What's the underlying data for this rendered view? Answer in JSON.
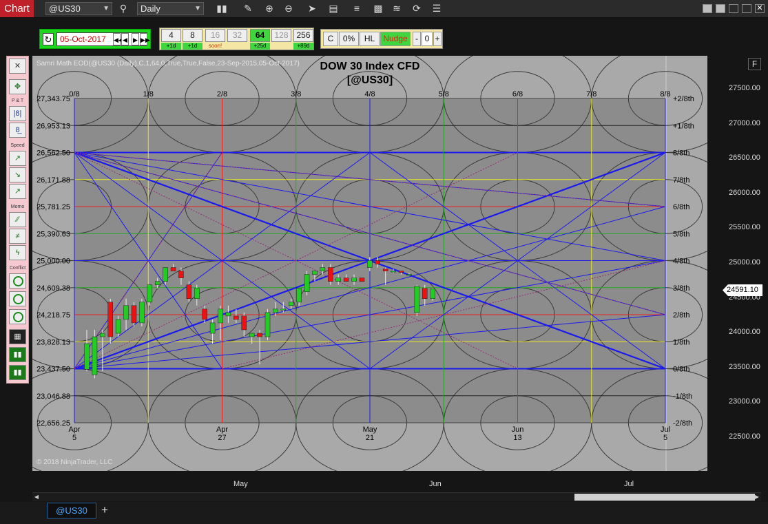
{
  "titlebar": {
    "app_tab": "Chart",
    "instrument": "@US30",
    "period": "Daily"
  },
  "toolbar2": {
    "date": "05-Oct-2017",
    "zoom_levels": [
      {
        "value": "4",
        "label": "+1d"
      },
      {
        "value": "8",
        "label": "+1d"
      },
      {
        "value": "16",
        "label": "soon!"
      },
      {
        "value": "32",
        "label": ""
      },
      {
        "value": "64",
        "label": "+25d"
      },
      {
        "value": "128",
        "label": ""
      },
      {
        "value": "256",
        "label": "+89d"
      }
    ],
    "mode_buttons": [
      "C",
      "0%",
      "HL",
      "Nudge"
    ],
    "nudge_minus": "-",
    "nudge_value": "0",
    "nudge_plus": "+"
  },
  "left_panel": {
    "labels": [
      "P & T",
      "Speed",
      "Momo",
      "Conflict"
    ]
  },
  "chart": {
    "header_text": "Samri Math EOD(@US30 (Daily),C,1,64,0,True,True,False,23-Sep-2015,05-Oct-2017)",
    "title_line1": "DOW 30 Index CFD",
    "title_line2": "[@US30]",
    "copyright": "© 2018 NinjaTrader, LLC",
    "f_button": "F",
    "last_price": "24591.10"
  },
  "chart_data": {
    "type": "candlestick",
    "grid_price_labels": [
      "27,343.75",
      "26,953.13",
      "26,562.50",
      "26,171.88",
      "25,781.25",
      "25,390.63",
      "25,000.00",
      "24,609.38",
      "24,218.75",
      "23,828.13",
      "23,437.50",
      "23,046.88",
      "22,656.25"
    ],
    "grid_octave_labels": [
      "+2/8th",
      "+1/8th",
      "8/8th",
      "7/8th",
      "6/8th",
      "5/8th",
      "4/8th",
      "3/8th",
      "2/8th",
      "1/8th",
      "0/8th",
      "-1/8th",
      "-2/8th"
    ],
    "time_fraction_labels": [
      "0/8",
      "1/8",
      "2/8",
      "3/8",
      "4/8",
      "5/8",
      "6/8",
      "7/8",
      "8/8"
    ],
    "inner_x_labels": [
      {
        "month": "Apr",
        "day": "5"
      },
      {
        "month": "Apr",
        "day": "27"
      },
      {
        "month": "May",
        "day": "21"
      },
      {
        "month": "Jun",
        "day": "13"
      },
      {
        "month": "Jul",
        "day": "5"
      }
    ],
    "right_axis_labels": [
      "27500.00",
      "27000.00",
      "26500.00",
      "26000.00",
      "25500.00",
      "25000.00",
      "24500.00",
      "24000.00",
      "23500.00",
      "23000.00",
      "22500.00"
    ],
    "bottom_axis_labels": [
      "May",
      "Jun",
      "Jul"
    ],
    "candles": [
      {
        "o": 23430,
        "h": 24000,
        "l": 23400,
        "c": 23800
      },
      {
        "o": 23350,
        "h": 24000,
        "l": 23300,
        "c": 23900
      },
      {
        "o": 23900,
        "h": 24000,
        "l": 23400,
        "c": 23950
      },
      {
        "o": 24400,
        "h": 24450,
        "l": 23800,
        "c": 23900
      },
      {
        "o": 23950,
        "h": 24200,
        "l": 23900,
        "c": 24150
      },
      {
        "o": 24150,
        "h": 24450,
        "l": 24000,
        "c": 24350
      },
      {
        "o": 24350,
        "h": 24400,
        "l": 24050,
        "c": 24100
      },
      {
        "o": 24100,
        "h": 24450,
        "l": 24050,
        "c": 24400
      },
      {
        "o": 24400,
        "h": 24650,
        "l": 24350,
        "c": 24650
      },
      {
        "o": 24650,
        "h": 24750,
        "l": 24600,
        "c": 24700
      },
      {
        "o": 24700,
        "h": 24900,
        "l": 24650,
        "c": 24900
      },
      {
        "o": 24900,
        "h": 24950,
        "l": 24850,
        "c": 24850
      },
      {
        "o": 24850,
        "h": 24900,
        "l": 24650,
        "c": 24750
      },
      {
        "o": 24650,
        "h": 24700,
        "l": 24400,
        "c": 24450
      },
      {
        "o": 24450,
        "h": 24650,
        "l": 24350,
        "c": 24600
      },
      {
        "o": 24300,
        "h": 24350,
        "l": 24100,
        "c": 24150
      },
      {
        "o": 23950,
        "h": 24150,
        "l": 23800,
        "c": 24100
      },
      {
        "o": 24100,
        "h": 24350,
        "l": 23850,
        "c": 24300
      },
      {
        "o": 24200,
        "h": 24350,
        "l": 24100,
        "c": 24250
      },
      {
        "o": 24200,
        "h": 24300,
        "l": 24100,
        "c": 24150
      },
      {
        "o": 24200,
        "h": 24250,
        "l": 23900,
        "c": 24000
      },
      {
        "o": 23900,
        "h": 23950,
        "l": 23800,
        "c": 23950
      },
      {
        "o": 23950,
        "h": 24000,
        "l": 23500,
        "c": 23900
      },
      {
        "o": 23900,
        "h": 24300,
        "l": 23850,
        "c": 24250
      },
      {
        "o": 24250,
        "h": 24400,
        "l": 24200,
        "c": 24300
      },
      {
        "o": 24300,
        "h": 24400,
        "l": 24250,
        "c": 24300
      },
      {
        "o": 24350,
        "h": 24450,
        "l": 24300,
        "c": 24400
      },
      {
        "o": 24400,
        "h": 24600,
        "l": 24350,
        "c": 24600
      },
      {
        "o": 24550,
        "h": 24850,
        "l": 24500,
        "c": 24800
      },
      {
        "o": 24800,
        "h": 24850,
        "l": 24700,
        "c": 24850
      },
      {
        "o": 24850,
        "h": 24950,
        "l": 24800,
        "c": 24900
      },
      {
        "o": 24900,
        "h": 24950,
        "l": 24650,
        "c": 24700
      },
      {
        "o": 24700,
        "h": 24800,
        "l": 24650,
        "c": 24750
      },
      {
        "o": 24750,
        "h": 24800,
        "l": 24700,
        "c": 24700
      },
      {
        "o": 24700,
        "h": 24800,
        "l": 24650,
        "c": 24750
      },
      {
        "o": 24750,
        "h": 24750,
        "l": 24700,
        "c": 24700
      },
      {
        "o": 24900,
        "h": 25050,
        "l": 24850,
        "c": 25000
      },
      {
        "o": 25000,
        "h": 25050,
        "l": 24900,
        "c": 24950
      },
      {
        "o": 24880,
        "h": 24900,
        "l": 24650,
        "c": 24850
      },
      {
        "o": 24850,
        "h": 24880,
        "l": 24820,
        "c": 24850
      },
      {
        "o": 24850,
        "h": 24850,
        "l": 24800,
        "c": 24830
      },
      {
        "o": 24800,
        "h": 24820,
        "l": 24780,
        "c": 24800
      },
      {
        "o": 24250,
        "h": 24650,
        "l": 24200,
        "c": 24630
      },
      {
        "o": 24600,
        "h": 24650,
        "l": 24350,
        "c": 24450
      },
      {
        "o": 24450,
        "h": 24600,
        "l": 24420,
        "c": 24591
      }
    ]
  }
}
